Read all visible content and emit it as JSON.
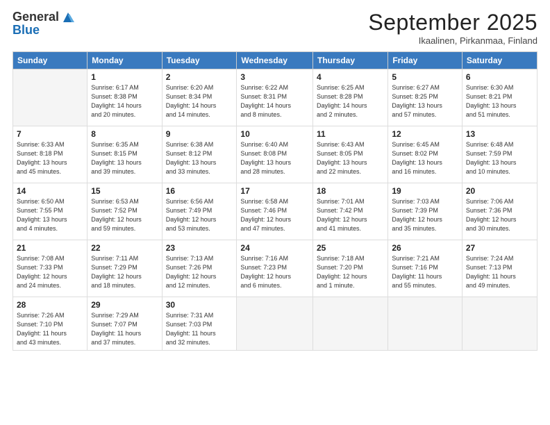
{
  "logo": {
    "general": "General",
    "blue": "Blue"
  },
  "title": "September 2025",
  "location": "Ikaalinen, Pirkanmaa, Finland",
  "days_of_week": [
    "Sunday",
    "Monday",
    "Tuesday",
    "Wednesday",
    "Thursday",
    "Friday",
    "Saturday"
  ],
  "weeks": [
    [
      {
        "day": "",
        "info": ""
      },
      {
        "day": "1",
        "info": "Sunrise: 6:17 AM\nSunset: 8:38 PM\nDaylight: 14 hours\nand 20 minutes."
      },
      {
        "day": "2",
        "info": "Sunrise: 6:20 AM\nSunset: 8:34 PM\nDaylight: 14 hours\nand 14 minutes."
      },
      {
        "day": "3",
        "info": "Sunrise: 6:22 AM\nSunset: 8:31 PM\nDaylight: 14 hours\nand 8 minutes."
      },
      {
        "day": "4",
        "info": "Sunrise: 6:25 AM\nSunset: 8:28 PM\nDaylight: 14 hours\nand 2 minutes."
      },
      {
        "day": "5",
        "info": "Sunrise: 6:27 AM\nSunset: 8:25 PM\nDaylight: 13 hours\nand 57 minutes."
      },
      {
        "day": "6",
        "info": "Sunrise: 6:30 AM\nSunset: 8:21 PM\nDaylight: 13 hours\nand 51 minutes."
      }
    ],
    [
      {
        "day": "7",
        "info": "Sunrise: 6:33 AM\nSunset: 8:18 PM\nDaylight: 13 hours\nand 45 minutes."
      },
      {
        "day": "8",
        "info": "Sunrise: 6:35 AM\nSunset: 8:15 PM\nDaylight: 13 hours\nand 39 minutes."
      },
      {
        "day": "9",
        "info": "Sunrise: 6:38 AM\nSunset: 8:12 PM\nDaylight: 13 hours\nand 33 minutes."
      },
      {
        "day": "10",
        "info": "Sunrise: 6:40 AM\nSunset: 8:08 PM\nDaylight: 13 hours\nand 28 minutes."
      },
      {
        "day": "11",
        "info": "Sunrise: 6:43 AM\nSunset: 8:05 PM\nDaylight: 13 hours\nand 22 minutes."
      },
      {
        "day": "12",
        "info": "Sunrise: 6:45 AM\nSunset: 8:02 PM\nDaylight: 13 hours\nand 16 minutes."
      },
      {
        "day": "13",
        "info": "Sunrise: 6:48 AM\nSunset: 7:59 PM\nDaylight: 13 hours\nand 10 minutes."
      }
    ],
    [
      {
        "day": "14",
        "info": "Sunrise: 6:50 AM\nSunset: 7:55 PM\nDaylight: 13 hours\nand 4 minutes."
      },
      {
        "day": "15",
        "info": "Sunrise: 6:53 AM\nSunset: 7:52 PM\nDaylight: 12 hours\nand 59 minutes."
      },
      {
        "day": "16",
        "info": "Sunrise: 6:56 AM\nSunset: 7:49 PM\nDaylight: 12 hours\nand 53 minutes."
      },
      {
        "day": "17",
        "info": "Sunrise: 6:58 AM\nSunset: 7:46 PM\nDaylight: 12 hours\nand 47 minutes."
      },
      {
        "day": "18",
        "info": "Sunrise: 7:01 AM\nSunset: 7:42 PM\nDaylight: 12 hours\nand 41 minutes."
      },
      {
        "day": "19",
        "info": "Sunrise: 7:03 AM\nSunset: 7:39 PM\nDaylight: 12 hours\nand 35 minutes."
      },
      {
        "day": "20",
        "info": "Sunrise: 7:06 AM\nSunset: 7:36 PM\nDaylight: 12 hours\nand 30 minutes."
      }
    ],
    [
      {
        "day": "21",
        "info": "Sunrise: 7:08 AM\nSunset: 7:33 PM\nDaylight: 12 hours\nand 24 minutes."
      },
      {
        "day": "22",
        "info": "Sunrise: 7:11 AM\nSunset: 7:29 PM\nDaylight: 12 hours\nand 18 minutes."
      },
      {
        "day": "23",
        "info": "Sunrise: 7:13 AM\nSunset: 7:26 PM\nDaylight: 12 hours\nand 12 minutes."
      },
      {
        "day": "24",
        "info": "Sunrise: 7:16 AM\nSunset: 7:23 PM\nDaylight: 12 hours\nand 6 minutes."
      },
      {
        "day": "25",
        "info": "Sunrise: 7:18 AM\nSunset: 7:20 PM\nDaylight: 12 hours\nand 1 minute."
      },
      {
        "day": "26",
        "info": "Sunrise: 7:21 AM\nSunset: 7:16 PM\nDaylight: 11 hours\nand 55 minutes."
      },
      {
        "day": "27",
        "info": "Sunrise: 7:24 AM\nSunset: 7:13 PM\nDaylight: 11 hours\nand 49 minutes."
      }
    ],
    [
      {
        "day": "28",
        "info": "Sunrise: 7:26 AM\nSunset: 7:10 PM\nDaylight: 11 hours\nand 43 minutes."
      },
      {
        "day": "29",
        "info": "Sunrise: 7:29 AM\nSunset: 7:07 PM\nDaylight: 11 hours\nand 37 minutes."
      },
      {
        "day": "30",
        "info": "Sunrise: 7:31 AM\nSunset: 7:03 PM\nDaylight: 11 hours\nand 32 minutes."
      },
      {
        "day": "",
        "info": ""
      },
      {
        "day": "",
        "info": ""
      },
      {
        "day": "",
        "info": ""
      },
      {
        "day": "",
        "info": ""
      }
    ]
  ]
}
